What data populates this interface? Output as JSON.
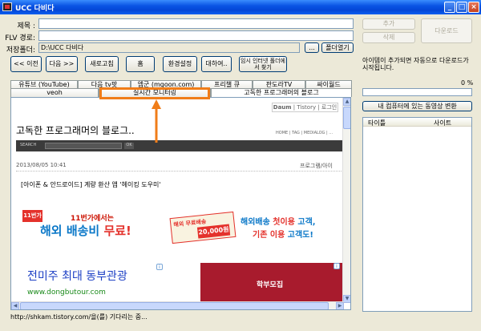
{
  "window": {
    "title": "UCC 다비다",
    "minimize": "_",
    "maximize": "□",
    "close": "×"
  },
  "form": {
    "title_label": "제목 :",
    "title_value": "",
    "flv_label": "FLV 경로:",
    "flv_value": "",
    "save_label": "저장폴더:",
    "save_value": "D:\\UCC 다비다",
    "browse_label": "...",
    "open_folder_label": "폴더열기"
  },
  "toolbar": {
    "back": "<< 이전",
    "forward": "다음 >>",
    "refresh": "새로고침",
    "home": "홈",
    "settings": "환경설정",
    "about": "대하여..",
    "temp_folder": "임시 인터넷 폴더에서 찾기"
  },
  "right_buttons": {
    "add": "추가",
    "delete": "삭제",
    "download": "다운로드"
  },
  "info_text": "아이템이 추가되면 자동으로 다운로드가 시작됩니다.",
  "progress": {
    "percent_text": "0 %",
    "value": 0
  },
  "convert_button": "내 컴퓨터에 있는 동영상 변환",
  "list": {
    "columns": [
      "타이틀",
      "사이트"
    ]
  },
  "tabs_row1": [
    "유튜브 (YouTube)",
    "다음 tv팟",
    "엠군 (mgoon.com)",
    "프리챌 큐",
    "판도라TV",
    "싸이월드"
  ],
  "tabs_row2": [
    "veoh",
    "실시간 모니터링",
    "고독한 프로그래머의 블로그"
  ],
  "active_tab": "고독한 프로그래머의 블로그",
  "page": {
    "daum_links": [
      "Daum",
      "Tistory",
      "로그인"
    ],
    "blog_title": "고독한 프로그래머의 블로그..",
    "nav_links": "HOME | TAG | MEDIALOG | ...",
    "search_label": "SEARCH",
    "search_btn": "OK",
    "post_date": "2013/08/05 10:41",
    "post_category": "프로그램/아이",
    "post_title": "[아이폰 & 안드로이드] 계량 환산 앱 '헤이킹 도우미'",
    "ad1_logo": "11번가",
    "ad1_line1": "11번가에서는",
    "ad1_line2a": "해외 배송비 ",
    "ad1_line2b": "무료!",
    "ad1_coupon_head": "해외 무료배송",
    "ad1_coupon_value": "20,000원",
    "ad1_right1a": "해외배송 ",
    "ad1_right1b": "첫이용",
    "ad1_right1c": " 고객,",
    "ad1_right2a": "기존 이용",
    "ad1_right2b": " 고객도!",
    "ad2_main": "전미주 최대 동부관광",
    "ad2_url": "www.dongbutour.com",
    "ad3_text": "학부모집"
  },
  "status_text": "http://shkam.tistory.com/을(를) 기다리는 중...",
  "colors": {
    "accent": "#f07d19",
    "titlebar": "#0a54e4",
    "ad_blue": "#0b78c8"
  }
}
